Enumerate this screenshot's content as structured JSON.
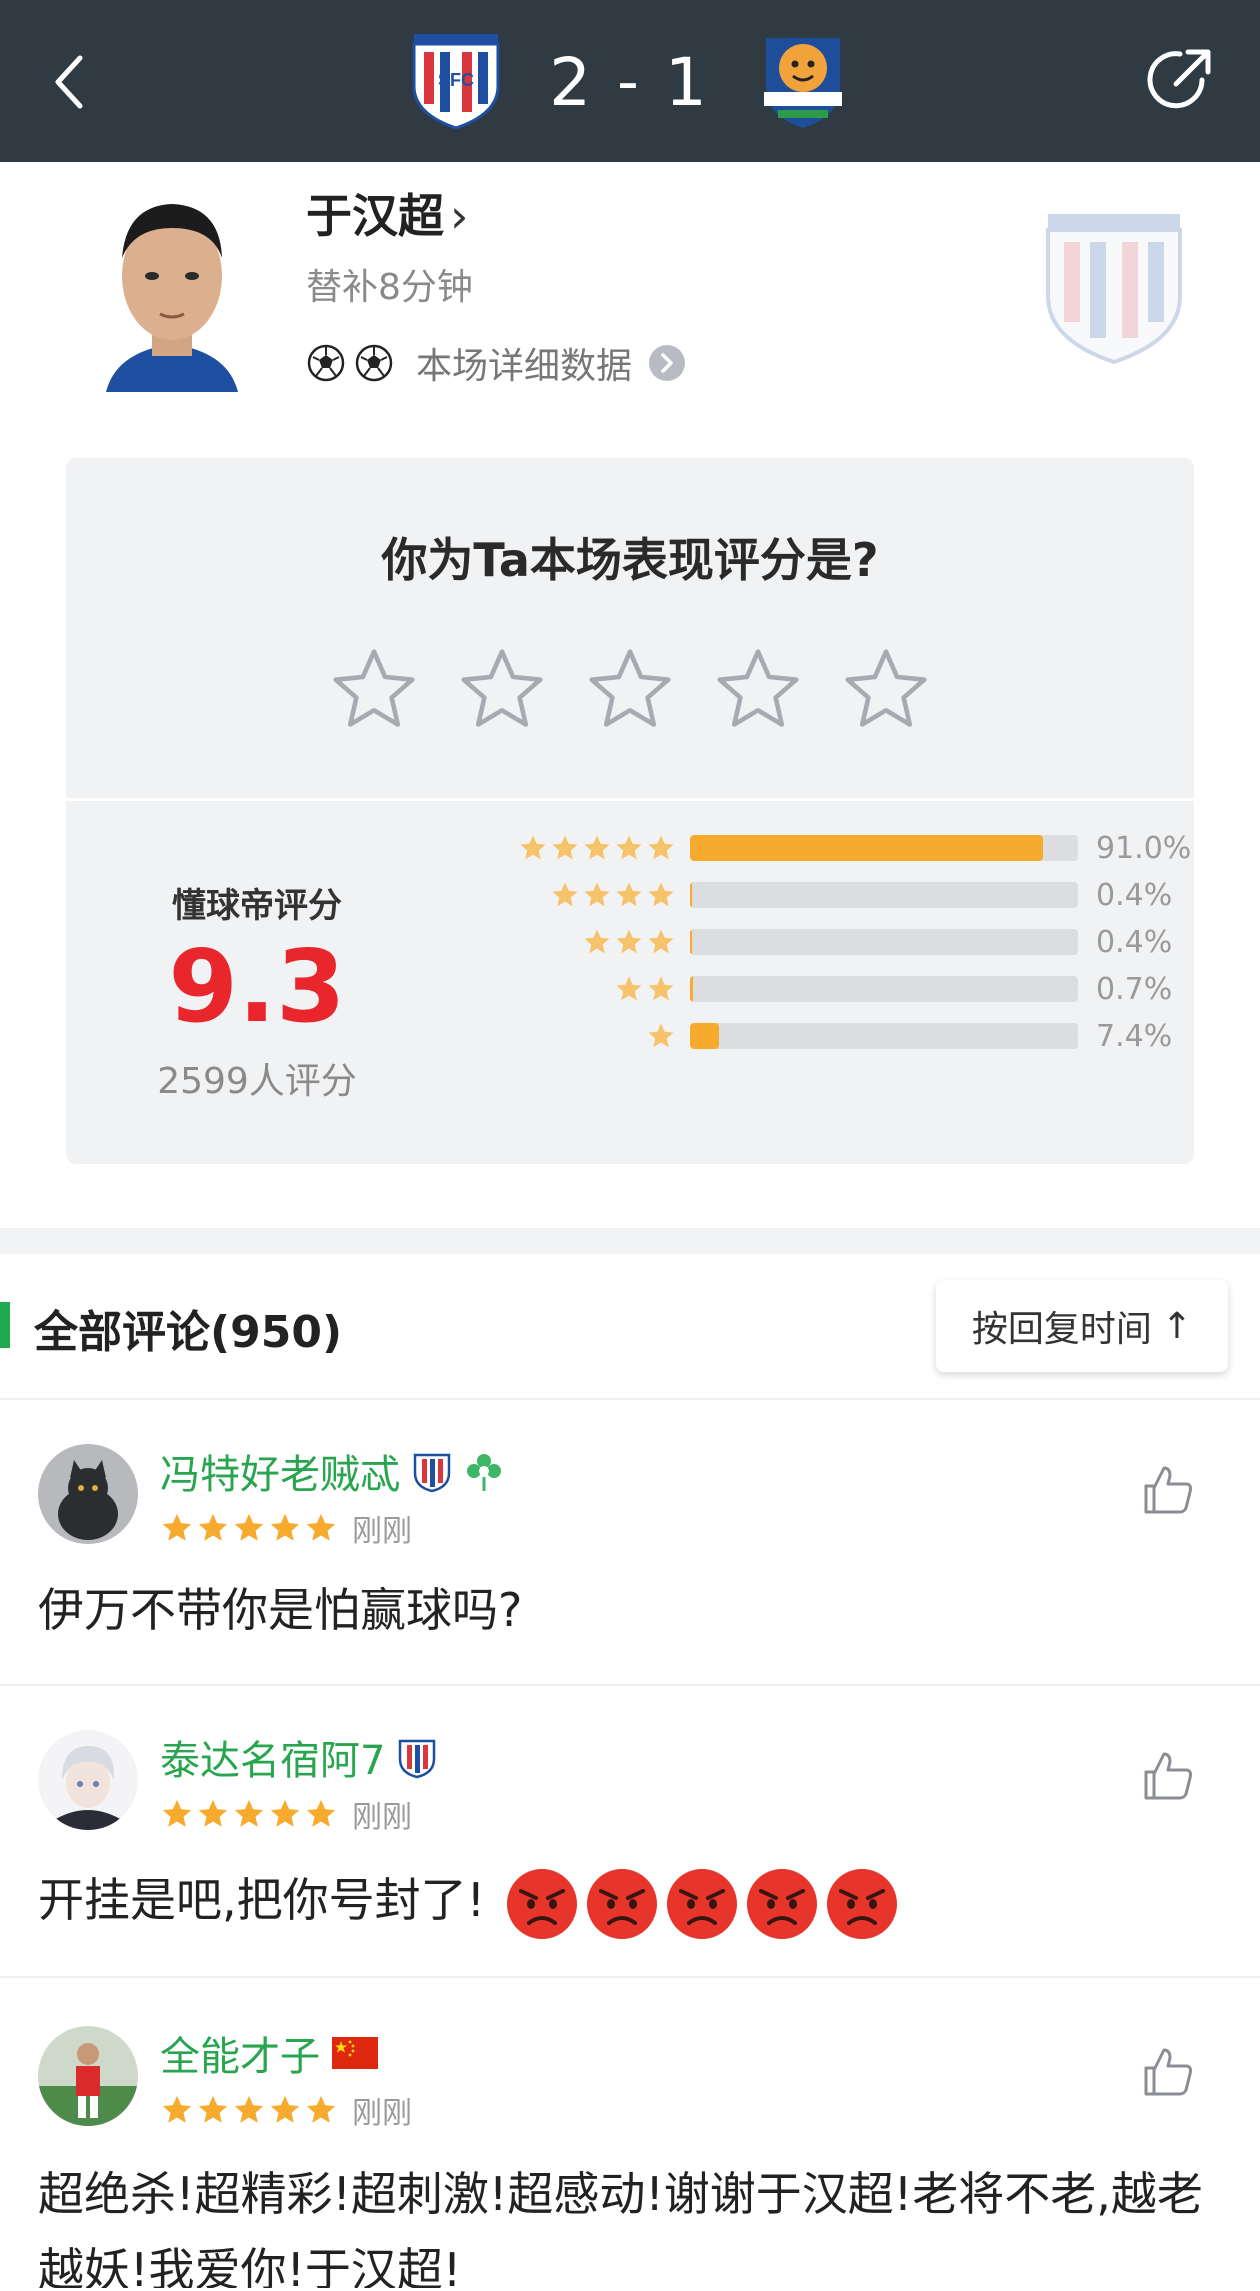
{
  "header": {
    "score_home": "2",
    "score_sep": "-",
    "score_away": "1",
    "home_crest_icon": "shenhua-crest-icon",
    "away_crest_icon": "jinmen-tiger-crest-icon"
  },
  "player": {
    "name": "于汉超",
    "name_chevron": "›",
    "sub": "替补8分钟",
    "details_label": "本场详细数据"
  },
  "rating_card": {
    "question": "你为Ta本场表现评分是?",
    "score_label": "懂球帝评分",
    "score_value": "9.3",
    "rater_count": "2599人评分",
    "distribution": [
      {
        "stars": 5,
        "percent_label": "91.0%",
        "fraction": 0.91
      },
      {
        "stars": 4,
        "percent_label": "0.4%",
        "fraction": 0.004
      },
      {
        "stars": 3,
        "percent_label": "0.4%",
        "fraction": 0.004
      },
      {
        "stars": 2,
        "percent_label": "0.7%",
        "fraction": 0.007
      },
      {
        "stars": 1,
        "percent_label": "7.4%",
        "fraction": 0.074
      }
    ]
  },
  "comments_section": {
    "title": "全部评论(950)",
    "sort_label": "按回复时间",
    "sort_arrow": "↑"
  },
  "comments": [
    {
      "user": "冯特好老贼忒",
      "stars": 5,
      "time": "刚刚",
      "text": "伊万不带你是怕赢球吗?",
      "badges": [
        "shenhua-badge-icon",
        "green-flower-badge-icon"
      ]
    },
    {
      "user": "泰达名宿阿7",
      "stars": 5,
      "time": "刚刚",
      "text": "开挂是吧,把你号封了!",
      "badges": [
        "shenhua-badge-icon"
      ],
      "emoji_count": 5
    },
    {
      "user": "全能才子",
      "stars": 5,
      "time": "刚刚",
      "text": "超绝杀!超精彩!超刺激!超感动!谢谢于汉超!老将不老,越老越妖!我爱你!于汉超!",
      "badges": [
        "china-flag-icon"
      ]
    }
  ],
  "colors": {
    "topbar": "#2f3a42",
    "accent_green": "#2aa54f",
    "score_red": "#e8262c",
    "bar_orange": "#f7ab2e"
  }
}
